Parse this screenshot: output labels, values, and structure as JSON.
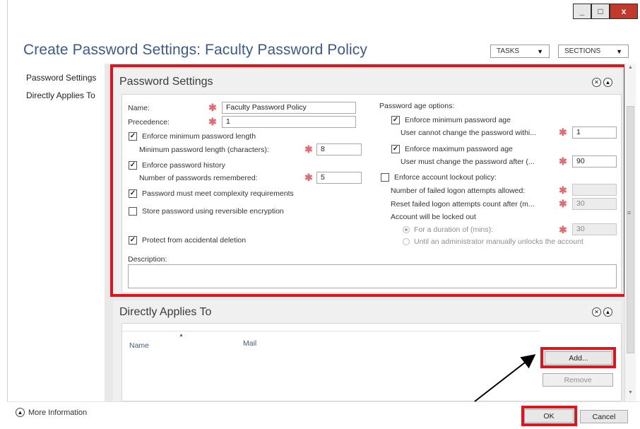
{
  "window": {
    "minimize": "_",
    "maximize": "□",
    "close": "x"
  },
  "header": {
    "title": "Create Password Settings: Faculty Password Policy",
    "tasks": "TASKS",
    "sections": "SECTIONS"
  },
  "nav": {
    "items": [
      "Password Settings",
      "Directly Applies To"
    ]
  },
  "password_settings": {
    "title": "Password Settings",
    "name_label": "Name:",
    "name_value": "Faculty Password Policy",
    "precedence_label": "Precedence:",
    "precedence_value": "1",
    "enforce_min_length": "Enforce minimum password length",
    "min_length_label": "Minimum password length (characters):",
    "min_length_value": "8",
    "enforce_history": "Enforce password history",
    "history_label": "Number of passwords remembered:",
    "history_value": "5",
    "complexity": "Password must meet complexity requirements",
    "reversible": "Store password using reversible encryption",
    "protect": "Protect from accidental deletion",
    "description_label": "Description:",
    "age_options": "Password age options:",
    "enforce_min_age": "Enforce minimum password age",
    "min_age_label": "User cannot change the password withi...",
    "min_age_value": "1",
    "enforce_max_age": "Enforce maximum password age",
    "max_age_label": "User must change the password after (...",
    "max_age_value": "90",
    "lockout": "Enforce account lockout policy:",
    "failed_attempts": "Number of failed logon attempts allowed:",
    "reset_count": "Reset failed logon attempts count after (m...",
    "reset_value": "30",
    "locked_out": "Account will be locked out",
    "duration": "For a duration of (mins):",
    "duration_value": "30",
    "until_admin": "Until an administrator manually unlocks the account"
  },
  "applies_to": {
    "title": "Directly Applies To",
    "col_name": "Name",
    "col_mail": "Mail",
    "add": "Add...",
    "remove": "Remove"
  },
  "footer": {
    "more_info": "More Information",
    "ok": "OK",
    "cancel": "Cancel"
  },
  "colors": {
    "accent_title": "#3d5a8c",
    "required_star": "#e46a72",
    "highlight": "#e0141c"
  }
}
